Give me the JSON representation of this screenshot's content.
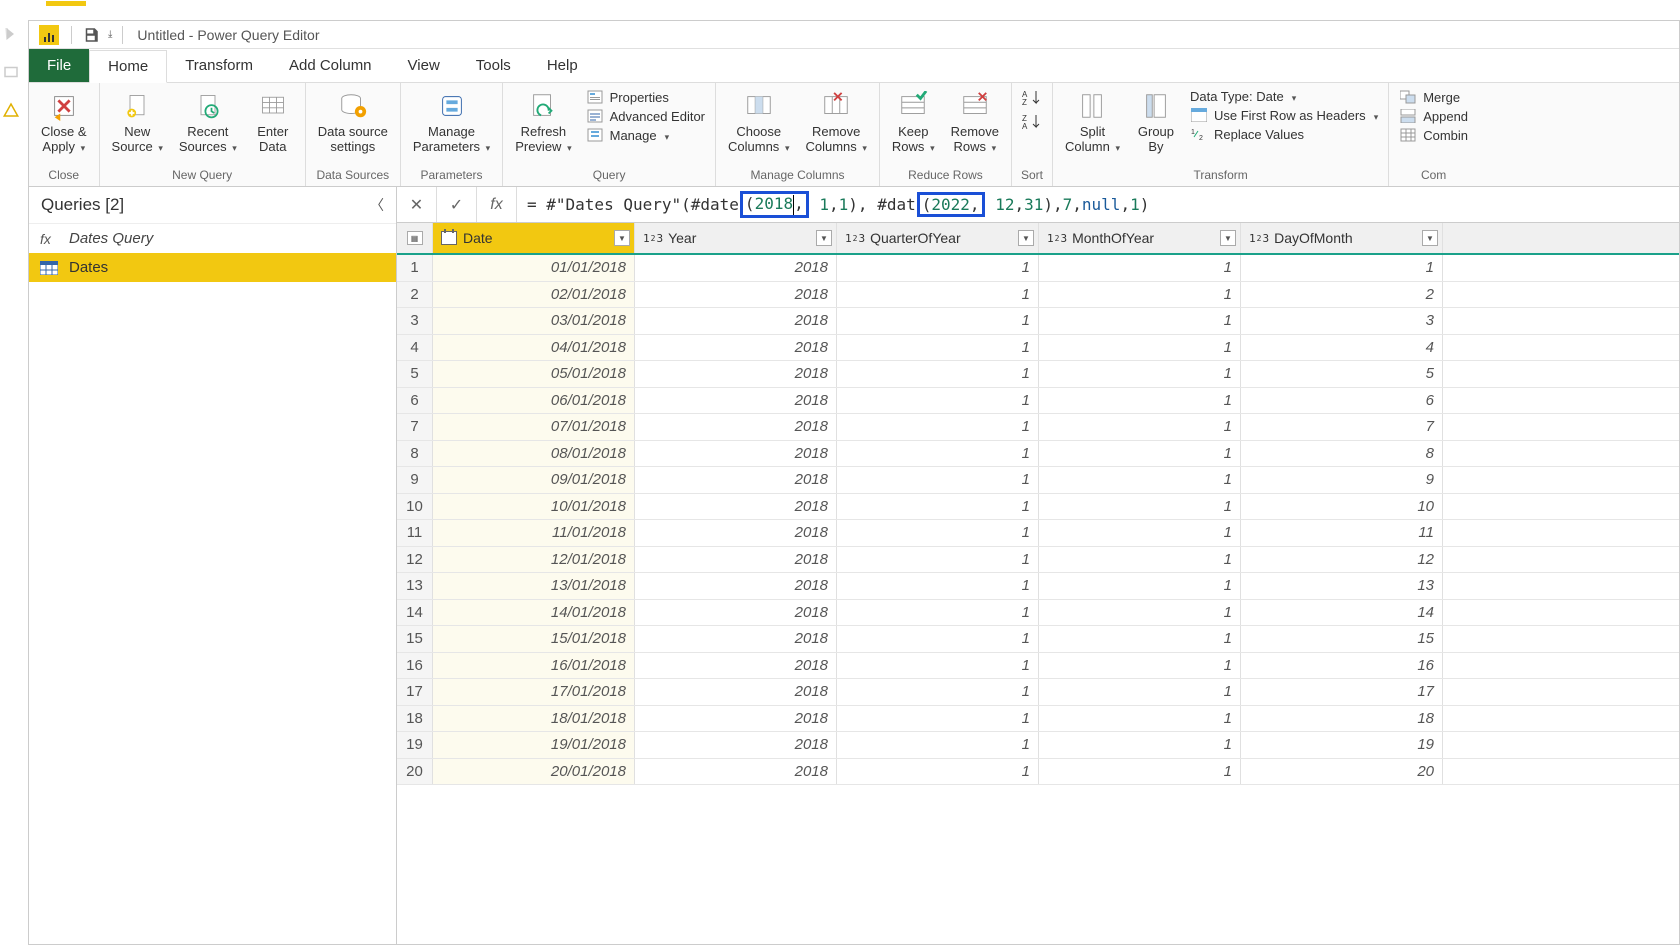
{
  "window": {
    "title": "Untitled - Power Query Editor"
  },
  "tabs": {
    "file": "File",
    "home": "Home",
    "transform": "Transform",
    "addcol": "Add Column",
    "view": "View",
    "tools": "Tools",
    "help": "Help"
  },
  "ribbon": {
    "close": {
      "closeApply": "Close &\nApply",
      "group": "Close"
    },
    "newquery": {
      "newSource": "New\nSource",
      "recent": "Recent\nSources",
      "enter": "Enter\nData",
      "group": "New Query"
    },
    "datasources": {
      "settings": "Data source\nsettings",
      "group": "Data Sources"
    },
    "parameters": {
      "manage": "Manage\nParameters",
      "group": "Parameters"
    },
    "query": {
      "refresh": "Refresh\nPreview",
      "properties": "Properties",
      "advEditor": "Advanced Editor",
      "manage": "Manage",
      "group": "Query"
    },
    "managecols": {
      "choose": "Choose\nColumns",
      "remove": "Remove\nColumns",
      "group": "Manage Columns"
    },
    "reducerows": {
      "keep": "Keep\nRows",
      "remove": "Remove\nRows",
      "group": "Reduce Rows"
    },
    "sort": {
      "group": "Sort"
    },
    "transform": {
      "split": "Split\nColumn",
      "groupby": "Group\nBy",
      "datatype": "Data Type: Date",
      "firstrow": "Use First Row as Headers",
      "replace": "Replace Values",
      "group": "Transform"
    },
    "combine": {
      "merge": "Merge",
      "append": "Append",
      "combine": "Combin",
      "group": "Com"
    }
  },
  "sidebar": {
    "title": "Queries [2]",
    "items": [
      {
        "name": "Dates Query",
        "type": "fn"
      },
      {
        "name": "Dates",
        "type": "table",
        "selected": true
      }
    ]
  },
  "formula": {
    "prefix": "= #\"Dates Query\"(#date",
    "h1open": "(",
    "h1val": "2018",
    "after1": " 1, 1), #dat",
    "h2open": "(",
    "h2val": "2022",
    "after2": " 12, 31), 7, ",
    "nullw": "null",
    "tail": ", 1)",
    "comma": ","
  },
  "columns": {
    "date": "Date",
    "year": "Year",
    "quarter": "QuarterOfYear",
    "month": "MonthOfYear",
    "day": "DayOfMonth"
  },
  "rows": [
    {
      "n": 1,
      "date": "01/01/2018",
      "year": 2018,
      "q": 1,
      "m": 1,
      "d": 1
    },
    {
      "n": 2,
      "date": "02/01/2018",
      "year": 2018,
      "q": 1,
      "m": 1,
      "d": 2
    },
    {
      "n": 3,
      "date": "03/01/2018",
      "year": 2018,
      "q": 1,
      "m": 1,
      "d": 3
    },
    {
      "n": 4,
      "date": "04/01/2018",
      "year": 2018,
      "q": 1,
      "m": 1,
      "d": 4
    },
    {
      "n": 5,
      "date": "05/01/2018",
      "year": 2018,
      "q": 1,
      "m": 1,
      "d": 5
    },
    {
      "n": 6,
      "date": "06/01/2018",
      "year": 2018,
      "q": 1,
      "m": 1,
      "d": 6
    },
    {
      "n": 7,
      "date": "07/01/2018",
      "year": 2018,
      "q": 1,
      "m": 1,
      "d": 7
    },
    {
      "n": 8,
      "date": "08/01/2018",
      "year": 2018,
      "q": 1,
      "m": 1,
      "d": 8
    },
    {
      "n": 9,
      "date": "09/01/2018",
      "year": 2018,
      "q": 1,
      "m": 1,
      "d": 9
    },
    {
      "n": 10,
      "date": "10/01/2018",
      "year": 2018,
      "q": 1,
      "m": 1,
      "d": 10
    },
    {
      "n": 11,
      "date": "11/01/2018",
      "year": 2018,
      "q": 1,
      "m": 1,
      "d": 11
    },
    {
      "n": 12,
      "date": "12/01/2018",
      "year": 2018,
      "q": 1,
      "m": 1,
      "d": 12
    },
    {
      "n": 13,
      "date": "13/01/2018",
      "year": 2018,
      "q": 1,
      "m": 1,
      "d": 13
    },
    {
      "n": 14,
      "date": "14/01/2018",
      "year": 2018,
      "q": 1,
      "m": 1,
      "d": 14
    },
    {
      "n": 15,
      "date": "15/01/2018",
      "year": 2018,
      "q": 1,
      "m": 1,
      "d": 15
    },
    {
      "n": 16,
      "date": "16/01/2018",
      "year": 2018,
      "q": 1,
      "m": 1,
      "d": 16
    },
    {
      "n": 17,
      "date": "17/01/2018",
      "year": 2018,
      "q": 1,
      "m": 1,
      "d": 17
    },
    {
      "n": 18,
      "date": "18/01/2018",
      "year": 2018,
      "q": 1,
      "m": 1,
      "d": 18
    },
    {
      "n": 19,
      "date": "19/01/2018",
      "year": 2018,
      "q": 1,
      "m": 1,
      "d": 19
    },
    {
      "n": 20,
      "date": "20/01/2018",
      "year": 2018,
      "q": 1,
      "m": 1,
      "d": 20
    }
  ]
}
